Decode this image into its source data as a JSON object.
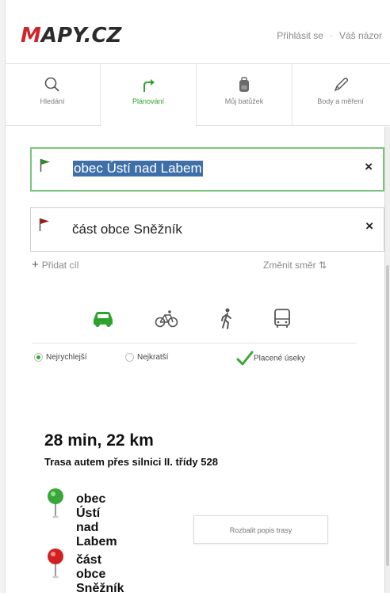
{
  "header": {
    "logo_prefix": "M",
    "logo_rest": "APY.CZ",
    "login": "Přihlásit se",
    "separator": "·",
    "feedback": "Váš názor"
  },
  "tabs": [
    {
      "label": "Hledání",
      "icon": "search-icon",
      "active": false
    },
    {
      "label": "Plánování",
      "icon": "route-icon",
      "active": true
    },
    {
      "label": "Můj batůžek",
      "icon": "backpack-icon",
      "active": false
    },
    {
      "label": "Body a měření",
      "icon": "pencil-icon",
      "active": false
    }
  ],
  "route": {
    "start": {
      "value": "obec Ústí nad Labem",
      "flag_color": "#2e8b2e"
    },
    "end": {
      "value": "část obce Sněžník",
      "flag_color": "#9b1c1c"
    },
    "close_glyph": "×",
    "add_target": "Přidat cíl",
    "add_plus": "+",
    "change_direction": "Změnit směr ⇅"
  },
  "transport_modes": [
    "car-icon",
    "bicycle-icon",
    "walk-icon",
    "bus-icon"
  ],
  "active_mode_color": "#2ea12e",
  "options": {
    "fastest": "Nejrychlejší",
    "shortest": "Nejkratší",
    "paid": "Placené úseky",
    "selected": "fastest"
  },
  "summary": {
    "time_distance": "28 min, 22 km",
    "route_desc": "Trasa autem přes silnici II. třídy 528",
    "start": "obec Ústí nad Labem",
    "end": "část obce Sněžník",
    "expand": "Rozbalit popis trasy"
  }
}
